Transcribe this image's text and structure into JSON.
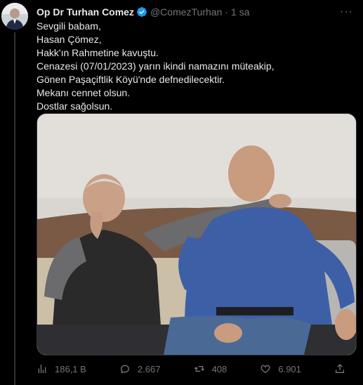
{
  "tweet": {
    "author_name": "Op Dr Turhan Comez",
    "handle": "@ComezTurhan",
    "separator": "·",
    "time": "1 sa",
    "more_label": "···",
    "lines": [
      "Sevgili babam,",
      "Hasan Çömez,",
      "Hakk'ın Rahmetine kavuştu.",
      "Cenazesi (07/01/2023) yarın ikindi namazını müteakip,",
      "Gönen Paşaçiftlik Köyü'nde defnedilecektir.",
      "Mekanı cennet olsun.",
      "Dostlar sağolsun."
    ]
  },
  "actions": {
    "views": "186,1 B",
    "replies": "2.667",
    "retweets": "408",
    "likes": "6.901"
  },
  "colors": {
    "background": "#000000",
    "text": "#e7e9ea",
    "muted": "#71767b",
    "verified": "#1d9bf0",
    "border": "#2f3336"
  },
  "icons": [
    "verified-badge-icon",
    "more-icon",
    "views-icon",
    "reply-icon",
    "retweet-icon",
    "like-icon",
    "share-icon"
  ]
}
